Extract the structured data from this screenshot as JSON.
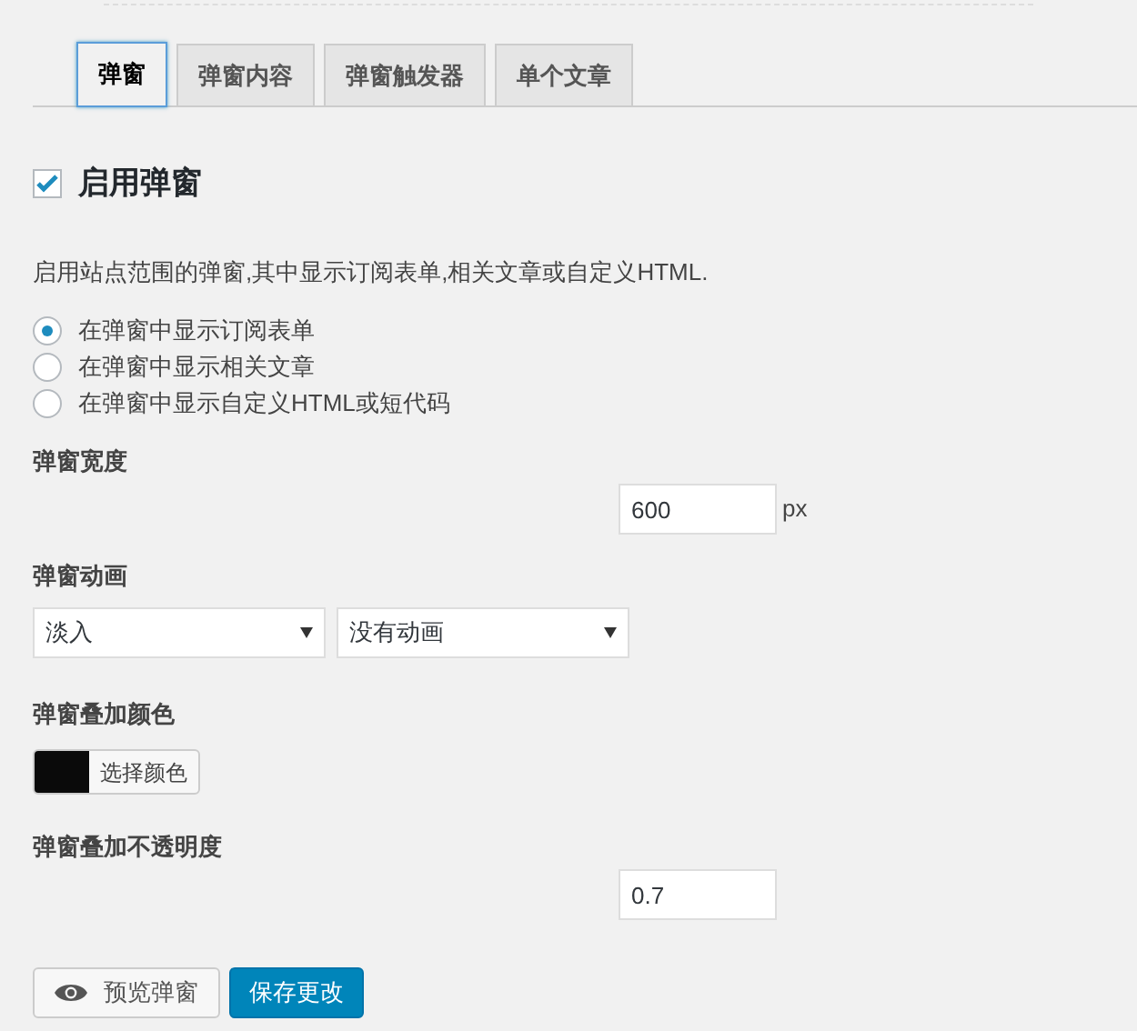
{
  "tabs": [
    {
      "label": "弹窗",
      "selected": true
    },
    {
      "label": "弹窗内容",
      "selected": false
    },
    {
      "label": "弹窗触发器",
      "selected": false
    },
    {
      "label": "单个文章",
      "selected": false
    }
  ],
  "enable": {
    "label": "启用弹窗",
    "checked": true
  },
  "description": "启用站点范围的弹窗,其中显示订阅表单,相关文章或自定义HTML.",
  "content_options": [
    {
      "label": "在弹窗中显示订阅表单",
      "selected": true
    },
    {
      "label": "在弹窗中显示相关文章",
      "selected": false
    },
    {
      "label": "在弹窗中显示自定义HTML或短代码",
      "selected": false
    }
  ],
  "width": {
    "label": "弹窗宽度",
    "value": "600",
    "unit": "px"
  },
  "animation": {
    "label": "弹窗动画",
    "selects": [
      "淡入",
      "没有动画"
    ]
  },
  "overlay_color": {
    "label": "弹窗叠加颜色",
    "color": "#0a0a0a",
    "button": "选择颜色"
  },
  "overlay_opacity": {
    "label": "弹窗叠加不透明度",
    "value": "0.7"
  },
  "buttons": [
    {
      "kind": "preview",
      "label": "预览弹窗"
    },
    {
      "kind": "primary",
      "label": "保存更改"
    }
  ]
}
